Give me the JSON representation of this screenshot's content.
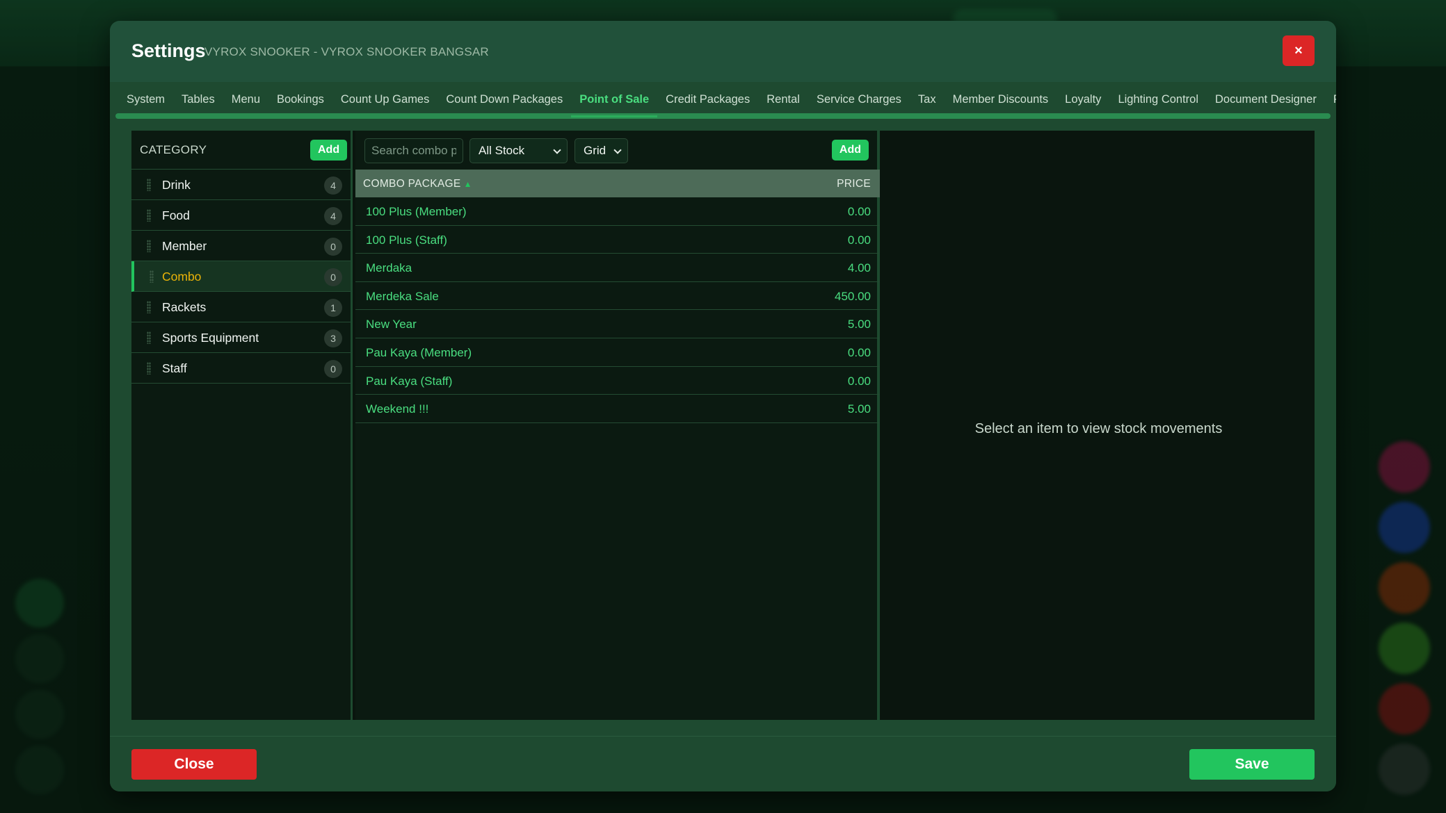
{
  "modal": {
    "title": "Settings",
    "subtitle": "VYROX SNOOKER - VYROX SNOOKER BANGSAR",
    "close_icon": "×"
  },
  "tabs": [
    {
      "label": "System"
    },
    {
      "label": "Tables"
    },
    {
      "label": "Menu"
    },
    {
      "label": "Bookings"
    },
    {
      "label": "Count Up Games"
    },
    {
      "label": "Count Down Packages"
    },
    {
      "label": "Point of Sale",
      "active": true
    },
    {
      "label": "Credit Packages"
    },
    {
      "label": "Rental"
    },
    {
      "label": "Service Charges"
    },
    {
      "label": "Tax"
    },
    {
      "label": "Member Discounts"
    },
    {
      "label": "Loyalty"
    },
    {
      "label": "Lighting Control"
    },
    {
      "label": "Document Designer"
    },
    {
      "label": "Printers"
    }
  ],
  "category": {
    "title": "CATEGORY",
    "add_label": "Add",
    "items": [
      {
        "name": "Drink",
        "count": "4"
      },
      {
        "name": "Food",
        "count": "4"
      },
      {
        "name": "Member",
        "count": "0"
      },
      {
        "name": "Combo",
        "count": "0",
        "active": true
      },
      {
        "name": "Rackets",
        "count": "1"
      },
      {
        "name": "Sports Equipment",
        "count": "3"
      },
      {
        "name": "Staff",
        "count": "0"
      }
    ]
  },
  "combo": {
    "search_placeholder": "Search combo p",
    "stock_filter": "All Stock",
    "view_mode": "Grid",
    "add_label": "Add",
    "columns": {
      "name": "COMBO PACKAGE",
      "sort_icon": "▲",
      "price": "PRICE"
    },
    "rows": [
      {
        "name": "100 Plus (Member)",
        "price": "0.00"
      },
      {
        "name": "100 Plus (Staff)",
        "price": "0.00"
      },
      {
        "name": "Merdaka",
        "price": "4.00"
      },
      {
        "name": "Merdeka Sale",
        "price": "450.00"
      },
      {
        "name": "New Year",
        "price": "5.00"
      },
      {
        "name": "Pau Kaya (Member)",
        "price": "0.00"
      },
      {
        "name": "Pau Kaya (Staff)",
        "price": "0.00"
      },
      {
        "name": "Weekend !!!",
        "price": "5.00"
      }
    ]
  },
  "stock": {
    "empty_message": "Select an item to view stock movements"
  },
  "footer": {
    "close_label": "Close",
    "save_label": "Save"
  },
  "colors": {
    "accent": "#22c55e",
    "danger": "#dc2626",
    "active_category": "#eab308"
  }
}
